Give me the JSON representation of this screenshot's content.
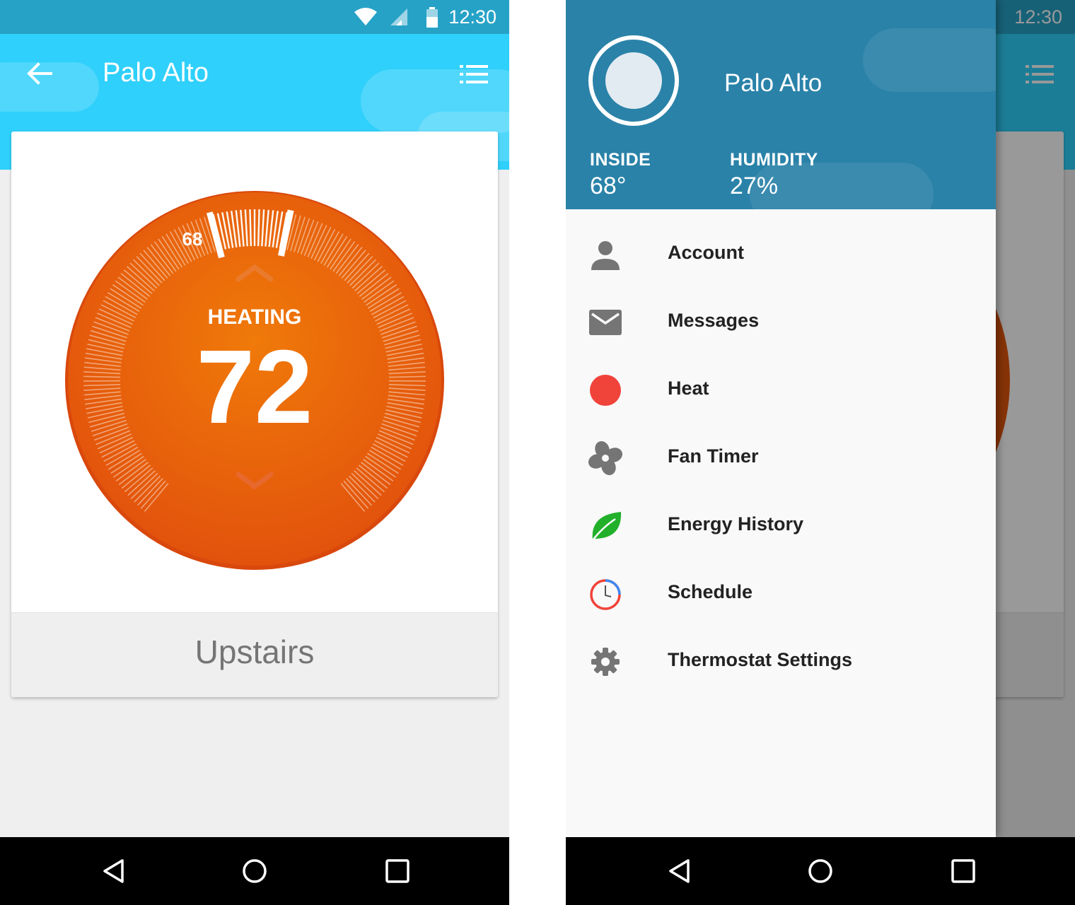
{
  "status": {
    "time": "12:30"
  },
  "appbar": {
    "title": "Palo Alto"
  },
  "thermostat": {
    "mode_label": "HEATING",
    "target_temp": "72",
    "current_temp_marker": "68",
    "mode_color": "#e85d04"
  },
  "card": {
    "footer_label": "Upstairs"
  },
  "drawer": {
    "title": "Palo Alto",
    "inside_label": "INSIDE",
    "inside_value": "68°",
    "humidity_label": "HUMIDITY",
    "humidity_value": "27%",
    "items": [
      {
        "label": "Account",
        "icon": "account-icon"
      },
      {
        "label": "Messages",
        "icon": "mail-icon"
      },
      {
        "label": "Heat",
        "icon": "heat-dot-icon"
      },
      {
        "label": "Fan Timer",
        "icon": "fan-icon"
      },
      {
        "label": "Energy History",
        "icon": "leaf-icon"
      },
      {
        "label": "Schedule",
        "icon": "clock-icon"
      },
      {
        "label": "Thermostat Settings",
        "icon": "gear-icon"
      }
    ]
  },
  "colors": {
    "appbar": "#2fd0fb",
    "statusbar": "#27a2c7",
    "drawer_header": "#2a82a8",
    "heat_red": "#f0433a",
    "leaf_green": "#22b02b"
  }
}
